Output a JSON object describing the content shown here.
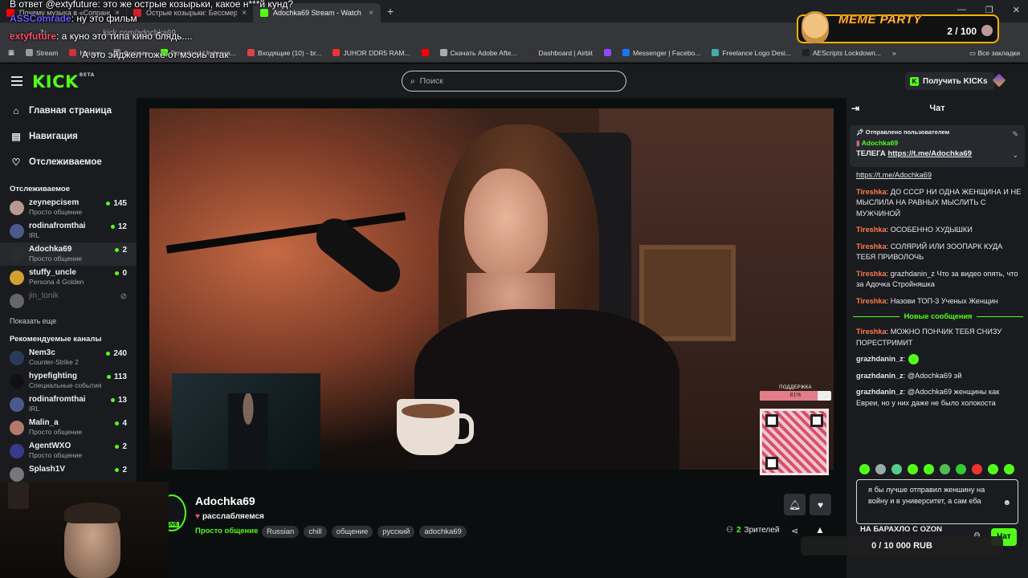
{
  "browser": {
    "tabs": [
      {
        "title": "Почему музыка в «Сопрано»",
        "color": "#ff0000",
        "close": "×"
      },
      {
        "title": "Острые козырьки: Бессмертн",
        "color": "#d41f27",
        "close": "×"
      },
      {
        "title": "Adochka69 Stream - Watch",
        "color": "#53fc18",
        "close": "×"
      }
    ],
    "new_tab": "+",
    "url": "kick.com/adochka69",
    "bookmarks": [
      {
        "label": "Stream",
        "color": "#999"
      },
      {
        "label": "Ницше",
        "color": "#c33"
      },
      {
        "label": "Форумы",
        "color": "#888"
      },
      {
        "label": "Download Underwa...",
        "color": "#53fc18"
      },
      {
        "label": "Входящие (10) - br...",
        "color": "#d44"
      },
      {
        "label": "JUHOR DDR5 RAM...",
        "color": "#e33"
      },
      {
        "label": "",
        "color": "#f00"
      },
      {
        "label": "Скачать Adobe Afte...",
        "color": "#aaa"
      },
      {
        "label": "Dashboard | Airbit",
        "color": "#333"
      },
      {
        "label": "",
        "color": "#9146ff"
      },
      {
        "label": "Messenger | Facebo...",
        "color": "#1877f2"
      },
      {
        "label": "Freelance Logo Desi...",
        "color": "#4aa"
      },
      {
        "label": "AEScripts Lockdown...",
        "color": "#222"
      }
    ],
    "bookmarks_more": "»",
    "all_bookmarks": "Все закладки"
  },
  "overlay_chat": [
    {
      "name": "",
      "text": "В ответ @extyfuture: это же острые козырьки, какое н***й кунд?",
      "color": "#fff"
    },
    {
      "name": "extyfuture",
      "text": ": а куно это типа кино блядь....",
      "color": "#ff4d6a"
    },
    {
      "name": "ASSComrade",
      "text": ": ну это фильм",
      "color": "#6a5cff"
    },
    {
      "name": "",
      "text": "А это эйджел тоже от мэсиь атак",
      "color": "#fff"
    }
  ],
  "meme_party": {
    "title": "MEME PARTY",
    "count": "2 / 100"
  },
  "header": {
    "logo": "KICK",
    "beta": "BETA",
    "search_placeholder": "Поиск",
    "get_kicks": "Получить KICKs"
  },
  "nav": [
    {
      "label": "Главная страница",
      "icon": "home-icon",
      "glyph": "⌂"
    },
    {
      "label": "Навигация",
      "icon": "browse-icon",
      "glyph": "▤"
    },
    {
      "label": "Отслеживаемое",
      "icon": "heart-icon",
      "glyph": "♡"
    }
  ],
  "following": {
    "title": "Отслеживаемое",
    "channels": [
      {
        "name": "zeynepcisem",
        "category": "Просто общение",
        "viewers": "145",
        "color": "#b89a8c"
      },
      {
        "name": "rodinafromthai",
        "category": "IRL",
        "viewers": "12",
        "color": "#4a5a8c"
      },
      {
        "name": "Adochka69",
        "category": "Просто общение",
        "viewers": "2",
        "color": "#2c2c2c"
      },
      {
        "name": "stuffy_uncle",
        "category": "Persona 4 Golden",
        "viewers": "0",
        "color": "#d4a030"
      },
      {
        "name": "jin_tonik",
        "category": "",
        "viewers": "",
        "color": "#666"
      }
    ],
    "show_more": "Показать еще"
  },
  "recommended": {
    "title": "Рекомендуемые каналы",
    "channels": [
      {
        "name": "Nem3c",
        "category": "Counter-Strike 2",
        "viewers": "240",
        "color": "#2c3a5a"
      },
      {
        "name": "hypefighting",
        "category": "Специальные события",
        "viewers": "113",
        "color": "#111"
      },
      {
        "name": "rodinafromthai",
        "category": "IRL",
        "viewers": "13",
        "color": "#4a5a8c"
      },
      {
        "name": "Malin_a",
        "category": "Просто общение",
        "viewers": "4",
        "color": "#b27a6a"
      },
      {
        "name": "AgentWXO",
        "category": "Просто общение",
        "viewers": "2",
        "color": "#3a3a8c"
      },
      {
        "name": "Splash1V",
        "category": "",
        "viewers": "2",
        "color": "#777"
      }
    ]
  },
  "stream": {
    "name": "Adochka69",
    "title": "расслабляемся",
    "category": "Просто общение",
    "tags": [
      "Russian",
      "chill",
      "общение",
      "русский",
      "adochka69"
    ],
    "viewers_count": "2",
    "viewers_label": "Зрителей",
    "live": "LIVE",
    "support_label": "ПОДДЕРЖКА",
    "support_pct": "81%",
    "support_fraction": 0.81
  },
  "chat": {
    "title": "Чат",
    "pinned": {
      "by": "Отправлено пользователем",
      "user": "Adochka69",
      "text": "ТЕЛЕГА",
      "link": "https://t.me/Adochka69"
    },
    "messages": [
      {
        "user": "",
        "text": "https://t.me/Adochka69",
        "color": "#e8e8e8"
      },
      {
        "user": "Tireshka",
        "text": ": ДО СССР НИ ОДНА ЖЕНЩИНА И НЕ МЫСЛИЛА НА РАВНЫХ МЫСЛИТЬ С МУЖЧИНОЙ",
        "color": "#ff7a4d"
      },
      {
        "user": "Tireshka",
        "text": ": ОСОБЕННО ХУДЫШКИ",
        "color": "#ff7a4d"
      },
      {
        "user": "Tireshka",
        "text": ": СОЛЯРИЙ ИЛИ ЗООПАРК КУДА ТЕБЯ ПРИВОЛОЧЬ",
        "color": "#ff7a4d"
      },
      {
        "user": "Tireshka",
        "text": ": grazhdanin_z Что за видео опять, что за Адочка Стройняшка",
        "color": "#ff7a4d"
      },
      {
        "user": "Tireshka",
        "text": ": Назови ТОП-3 Ученых Женщин",
        "color": "#ff7a4d"
      }
    ],
    "new_messages": "Новые сообщения",
    "messages2": [
      {
        "user": "Tireshka",
        "text": ": МОЖНО ПОНЧИК ТЕБЯ СНИЗУ ПОРЕСТРИМИТ",
        "color": "#ff7a4d"
      },
      {
        "user": "grazhdanin_z",
        "text": ":",
        "color": "#e8e8e8",
        "emote": true
      },
      {
        "user": "grazhdanin_z",
        "text": ": @Adochka69 эй",
        "color": "#e8e8e8"
      },
      {
        "user": "grazhdanin_z",
        "text": ": @Adochka69 женщины как Евреи, но у них даже не было холокоста",
        "color": "#e8e8e8"
      }
    ],
    "input_text": "я бы лучше отправил женшину на войну и в университет, а сам еба",
    "send_label": "Чат",
    "ozon": "НА БАРАХЛО С OZON",
    "donation": "0 / 10 000 RUB",
    "emotes": [
      "#53fc18",
      "#9aa",
      "#5c8",
      "#53fc18",
      "#53fc18",
      "#5b5",
      "#3c3",
      "#e33",
      "#53fc18",
      "#53fc18"
    ]
  },
  "colors": {
    "accent": "#53fc18",
    "bg": "#0b0e0f",
    "panel": "#191b1f"
  }
}
